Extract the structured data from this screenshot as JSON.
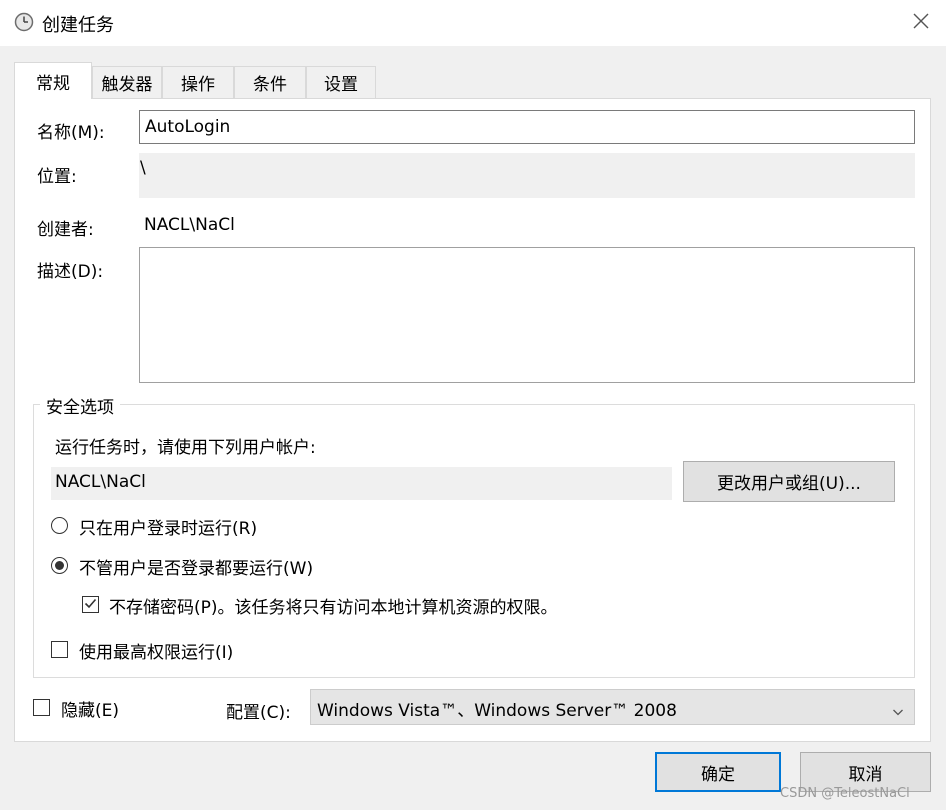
{
  "window": {
    "title": "创建任务",
    "icon": "clock-icon",
    "close_icon": "close-icon"
  },
  "tabs": [
    {
      "label": "常规",
      "active": true
    },
    {
      "label": "触发器",
      "active": false
    },
    {
      "label": "操作",
      "active": false
    },
    {
      "label": "条件",
      "active": false
    },
    {
      "label": "设置",
      "active": false
    }
  ],
  "general": {
    "name_label": "名称(M):",
    "name_value": "AutoLogin",
    "location_label": "位置:",
    "location_value": "\\",
    "author_label": "创建者:",
    "author_value": "NACL\\NaCl",
    "description_label": "描述(D):",
    "description_value": ""
  },
  "security": {
    "group_title": "安全选项",
    "run_as_prompt": "运行任务时，请使用下列用户帐户:",
    "user_account": "NACL\\NaCl",
    "change_user_button": "更改用户或组(U)...",
    "radio_logged_on": "只在用户登录时运行(R)",
    "radio_logged_on_selected": false,
    "radio_whether": "不管用户是否登录都要运行(W)",
    "radio_whether_selected": true,
    "no_store_password": "不存储密码(P)。该任务将只有访问本地计算机资源的权限。",
    "no_store_password_checked": true,
    "highest_privileges": "使用最高权限运行(I)",
    "highest_privileges_checked": false
  },
  "bottom": {
    "hidden_label": "隐藏(E)",
    "hidden_checked": false,
    "configure_label": "配置(C):",
    "configure_value": "Windows Vista™、Windows Server™ 2008"
  },
  "buttons": {
    "ok": "确定",
    "cancel": "取消"
  },
  "watermark": "CSDN @TeleostNaCl",
  "colors": {
    "accent_border": "#0078d7",
    "dialog_background": "#f0f0f0"
  }
}
